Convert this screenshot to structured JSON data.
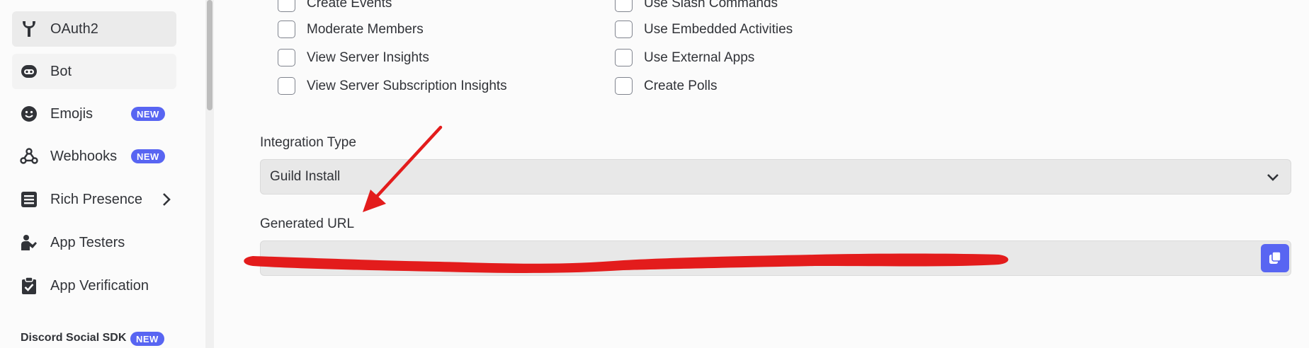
{
  "sidebar": {
    "items": [
      {
        "label": "OAuth2",
        "icon": "wrench-icon"
      },
      {
        "label": "Bot",
        "icon": "bot-icon"
      },
      {
        "label": "Emojis",
        "icon": "emoji-icon",
        "badge": "NEW"
      },
      {
        "label": "Webhooks",
        "icon": "webhook-icon",
        "badge": "NEW"
      },
      {
        "label": "Rich Presence",
        "icon": "rich-presence-icon"
      },
      {
        "label": "App Testers",
        "icon": "tester-icon"
      },
      {
        "label": "App Verification",
        "icon": "verification-icon"
      }
    ],
    "section": {
      "title": "Discord Social SDK",
      "badge": "NEW"
    }
  },
  "permissions": {
    "left": [
      "Create Events",
      "Moderate Members",
      "View Server Insights",
      "View Server Subscription Insights"
    ],
    "right": [
      "Use Slash Commands",
      "Use Embedded Activities",
      "Use External Apps",
      "Create Polls"
    ]
  },
  "integration": {
    "label": "Integration Type",
    "selected": "Guild Install"
  },
  "generated_url": {
    "label": "Generated URL",
    "value": ""
  },
  "colors": {
    "accent": "#5865f2",
    "annotation": "#e31c1c"
  }
}
